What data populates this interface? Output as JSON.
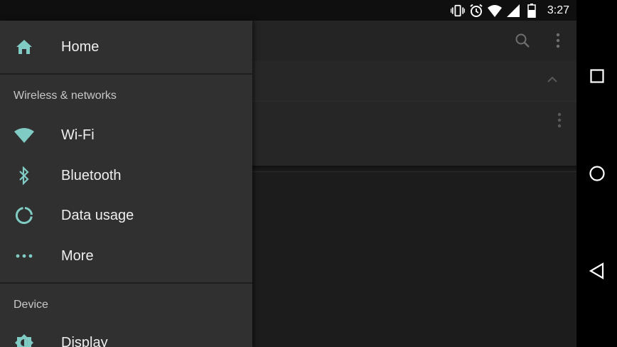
{
  "status_bar": {
    "time": "3:27",
    "icons": [
      "vibrate-icon",
      "alarm-icon",
      "wifi-signal-icon",
      "cell-signal-icon",
      "battery-icon"
    ]
  },
  "nav_bar": {
    "icons": [
      "recent-apps-icon",
      "home-circle-icon",
      "back-icon"
    ]
  },
  "app": {
    "icons": [
      "search-icon",
      "overflow-menu-icon",
      "chevron-up-icon",
      "overflow-menu-icon"
    ]
  },
  "drawer": {
    "home_label": "Home",
    "sections": [
      {
        "title": "Wireless & networks",
        "items": [
          {
            "label": "Wi-Fi",
            "icon": "wifi-icon"
          },
          {
            "label": "Bluetooth",
            "icon": "bluetooth-icon"
          },
          {
            "label": "Data usage",
            "icon": "data-usage-icon"
          },
          {
            "label": "More",
            "icon": "more-icon"
          }
        ]
      },
      {
        "title": "Device",
        "items": [
          {
            "label": "Display",
            "icon": "display-icon"
          }
        ]
      }
    ]
  },
  "colors": {
    "accent": "#80cbc4",
    "drawer_bg": "#303030",
    "text": "#eeeeee",
    "section_text": "#c8c8c8"
  }
}
